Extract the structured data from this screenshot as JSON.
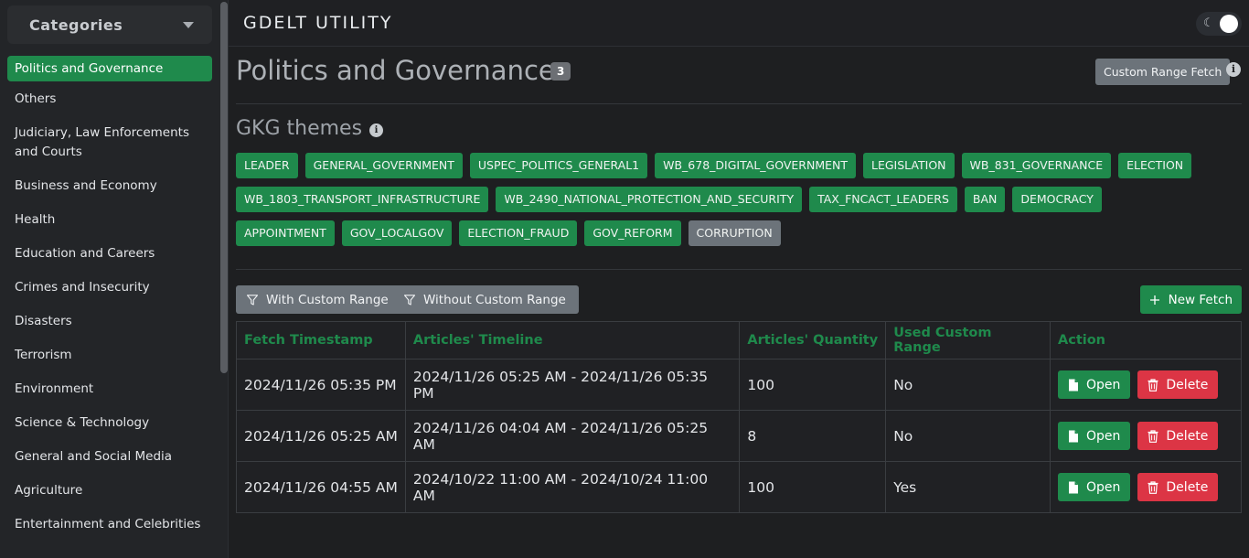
{
  "sidebar": {
    "header": "Categories",
    "items": [
      {
        "label": "Politics and Governance",
        "active": true
      },
      {
        "label": "Others"
      },
      {
        "label": "Judiciary, Law Enforcements and Courts"
      },
      {
        "label": "Business and Economy"
      },
      {
        "label": "Health"
      },
      {
        "label": "Education and Careers"
      },
      {
        "label": "Crimes and Insecurity"
      },
      {
        "label": "Disasters"
      },
      {
        "label": "Terrorism"
      },
      {
        "label": "Environment"
      },
      {
        "label": "Science & Technology"
      },
      {
        "label": "General and Social Media"
      },
      {
        "label": "Agriculture"
      },
      {
        "label": "Entertainment and Celebrities"
      }
    ]
  },
  "header": {
    "title": "GDELT UTILITY",
    "theme_icon": "moon-icon"
  },
  "page": {
    "title": "Politics and Governance",
    "count": "3",
    "custom_range_button": "Custom Range Fetch",
    "info_glyph": "i"
  },
  "gkg": {
    "title": "GKG themes",
    "themes": [
      {
        "label": "LEADER",
        "selected": true
      },
      {
        "label": "GENERAL_GOVERNMENT",
        "selected": true
      },
      {
        "label": "USPEC_POLITICS_GENERAL1",
        "selected": true
      },
      {
        "label": "WB_678_DIGITAL_GOVERNMENT",
        "selected": true
      },
      {
        "label": "LEGISLATION",
        "selected": true
      },
      {
        "label": "WB_831_GOVERNANCE",
        "selected": true
      },
      {
        "label": "ELECTION",
        "selected": true
      },
      {
        "label": "WB_1803_TRANSPORT_INFRASTRUCTURE",
        "selected": true
      },
      {
        "label": "WB_2490_NATIONAL_PROTECTION_AND_SECURITY",
        "selected": true
      },
      {
        "label": "TAX_FNCACT_LEADERS",
        "selected": true
      },
      {
        "label": "BAN",
        "selected": true
      },
      {
        "label": "DEMOCRACY",
        "selected": true
      },
      {
        "label": "APPOINTMENT",
        "selected": true
      },
      {
        "label": "GOV_LOCALGOV",
        "selected": true
      },
      {
        "label": "ELECTION_FRAUD",
        "selected": true
      },
      {
        "label": "GOV_REFORM",
        "selected": true
      },
      {
        "label": "CORRUPTION",
        "selected": false
      }
    ]
  },
  "filters": {
    "with_custom": "With Custom Range",
    "without_custom": "Without Custom Range",
    "new_fetch": "New Fetch"
  },
  "table": {
    "columns": [
      "Fetch Timestamp",
      "Articles' Timeline",
      "Articles' Quantity",
      "Used Custom Range",
      "Action"
    ],
    "rows": [
      {
        "timestamp": "2024/11/26 05:35 PM",
        "timeline": "2024/11/26 05:25 AM - 2024/11/26 05:35 PM",
        "quantity": "100",
        "custom": "No"
      },
      {
        "timestamp": "2024/11/26 05:25 AM",
        "timeline": "2024/11/26 04:04 AM - 2024/11/26 05:25 AM",
        "quantity": "8",
        "custom": "No"
      },
      {
        "timestamp": "2024/11/26 04:55 AM",
        "timeline": "2024/10/22 11:00 AM - 2024/10/24 11:00 AM",
        "quantity": "100",
        "custom": "Yes"
      }
    ],
    "open_label": "Open",
    "delete_label": "Delete"
  },
  "colors": {
    "accent_green": "#1f8a4c",
    "danger_red": "#dc3545",
    "secondary_gray": "#6c737a"
  }
}
